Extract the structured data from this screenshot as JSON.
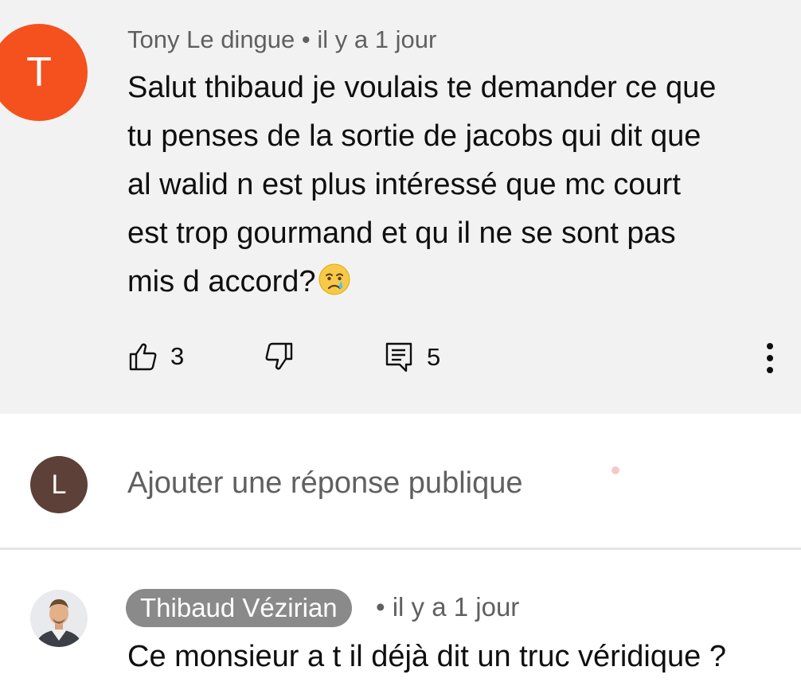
{
  "comment": {
    "avatar_letter": "T",
    "avatar_color": "#f4511e",
    "author": "Tony Le dingue",
    "separator": " • ",
    "time": "il y a 1 jour",
    "lines": [
      "Salut thibaud je voulais te demander ce que",
      "tu penses de la sortie de jacobs qui dit que",
      "al walid n est plus intéressé que mc court",
      "est trop gourmand et qu il ne se sont pas",
      "mis d accord?"
    ],
    "emoji": "crying-face",
    "likes": "3",
    "replies": "5"
  },
  "reply_box": {
    "avatar_letter": "L",
    "avatar_color": "#5d4037",
    "placeholder": "Ajouter une réponse publique"
  },
  "reply": {
    "author": "Thibaud Vézirian",
    "meta": "• il y a 1 jour",
    "text": "Ce monsieur a t il déjà dit un truc véridique ?"
  }
}
